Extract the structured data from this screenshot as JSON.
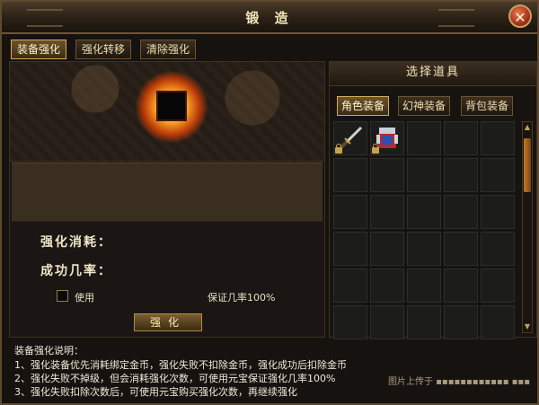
{
  "window": {
    "title": "锻 造",
    "close_glyph": "✕"
  },
  "tabs": [
    {
      "label": "装备强化",
      "active": true
    },
    {
      "label": "强化转移",
      "active": false
    },
    {
      "label": "清除强化",
      "active": false
    }
  ],
  "left": {
    "cost_label": "强化消耗：",
    "success_label": "成功几率：",
    "use_label": "使用",
    "guarantee_text": "保证几率100%",
    "enhance_button": "强化"
  },
  "right": {
    "header": "选择道具",
    "tabs": [
      {
        "label": "角色装备",
        "active": true
      },
      {
        "label": "幻神装备",
        "active": false
      },
      {
        "label": "背包装备",
        "active": false
      }
    ],
    "items": [
      {
        "icon": "sword-icon",
        "locked": true
      },
      {
        "icon": "armor-icon",
        "locked": true
      }
    ],
    "rows": 6,
    "cols": 5
  },
  "instructions": {
    "title": "装备强化说明：",
    "lines": [
      "1、强化装备优先消耗绑定金币，强化失败不扣除金币，强化成功后扣除金币",
      "2、强化失败不掉级，但会消耗强化次数，可使用元宝保证强化几率100%",
      "3、强化失败扣除次数后，可使用元宝购买强化次数，再继续强化"
    ]
  },
  "watermark": "图片上传于 ▪▪▪▪▪▪▪▪▪▪▪▪ ▪▪▪"
}
